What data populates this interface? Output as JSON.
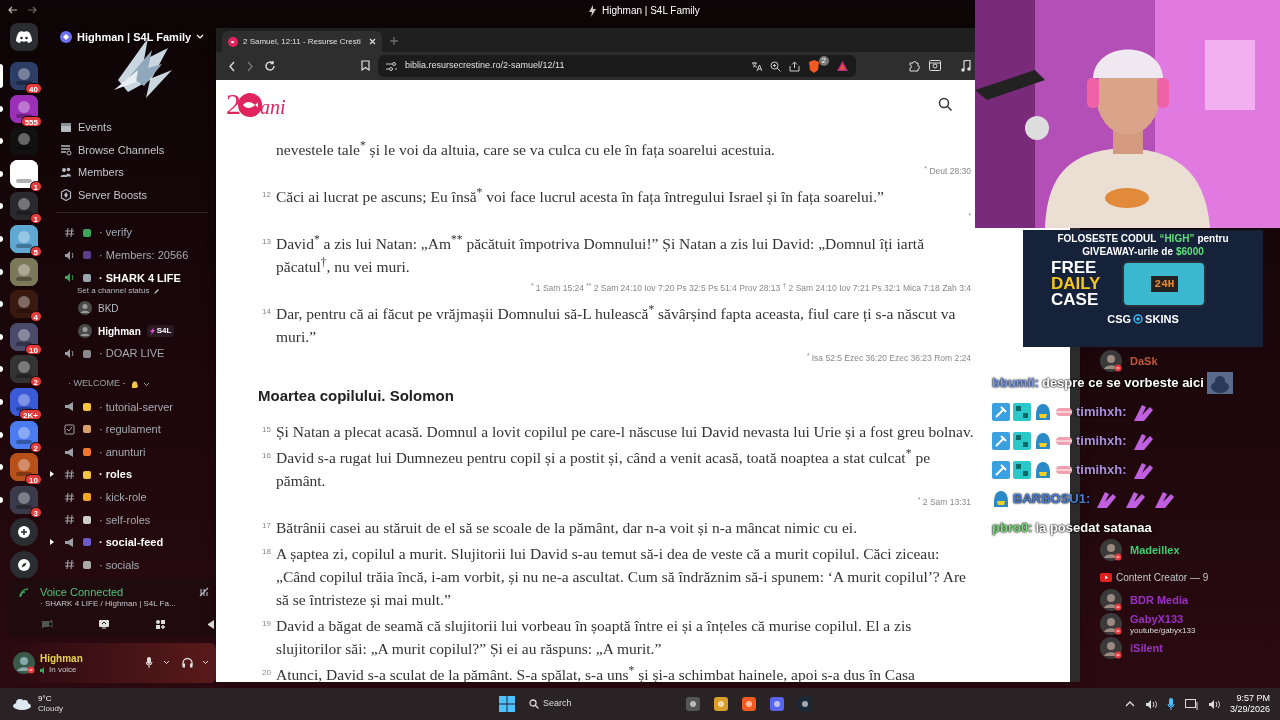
{
  "window_title": "Highman | S4L Family",
  "servers": [
    {
      "kind": "home",
      "selected": false,
      "unread": false,
      "color": "#2b2d31"
    },
    {
      "kind": "server",
      "selected": true,
      "unread": false,
      "badge": "40",
      "color": "#2c3e66"
    },
    {
      "kind": "server",
      "selected": false,
      "unread": true,
      "badge": "555",
      "color": "#9b2fb8"
    },
    {
      "kind": "server",
      "selected": false,
      "unread": true,
      "color": "#111111"
    },
    {
      "kind": "server",
      "selected": false,
      "unread": true,
      "badge": "1",
      "color": "#ffffff"
    },
    {
      "kind": "server",
      "selected": false,
      "unread": true,
      "badge": "1",
      "color": "#2a2a2e"
    },
    {
      "kind": "server",
      "selected": false,
      "unread": true,
      "badge": "5",
      "color": "#5fa8d3"
    },
    {
      "kind": "server",
      "selected": false,
      "unread": true,
      "color": "#7a7a5a"
    },
    {
      "kind": "server",
      "selected": false,
      "unread": true,
      "badge": "4",
      "color": "#3a1a10"
    },
    {
      "kind": "server",
      "selected": false,
      "unread": true,
      "badge": "10",
      "color": "#4a4a6a"
    },
    {
      "kind": "server",
      "selected": false,
      "unread": true,
      "badge": "2",
      "color": "#333333"
    },
    {
      "kind": "server",
      "selected": false,
      "unread": true,
      "badge": "2K+",
      "color": "#3a5ad8"
    },
    {
      "kind": "server",
      "selected": false,
      "unread": true,
      "badge": "2",
      "color": "#4a7cf0"
    },
    {
      "kind": "server",
      "selected": false,
      "unread": true,
      "badge": "10",
      "color": "#b8501a"
    },
    {
      "kind": "server",
      "selected": false,
      "unread": true,
      "badge": "3",
      "color": "#3a3a4a"
    },
    {
      "kind": "add",
      "selected": false,
      "unread": false,
      "color": "#2b2d31"
    },
    {
      "kind": "discover",
      "selected": false,
      "unread": false,
      "color": "#2b2d31"
    }
  ],
  "server_name": "Highman | S4L Family",
  "server_menu": [
    {
      "kind": "events",
      "label": "Events"
    },
    {
      "kind": "browse",
      "label": "Browse Channels"
    },
    {
      "kind": "members",
      "label": "Members"
    },
    {
      "kind": "boosts",
      "label": "Server Boosts"
    }
  ],
  "channels": [
    {
      "kind": "text",
      "name": "· verify",
      "bold": false,
      "unread": false,
      "color": "#3ba55c"
    },
    {
      "kind": "voice",
      "name": "· Members: 20566",
      "bold": false,
      "unread": false,
      "color": "#5b3e8c"
    },
    {
      "kind": "voice_active",
      "name": "· SHARK 4 LIFE",
      "bold": true,
      "unread": false,
      "color": "#9aa5b1",
      "status": "Set a channel status",
      "users": [
        {
          "name": "BKD"
        },
        {
          "name": "Highman",
          "tag": "S4L"
        }
      ]
    },
    {
      "kind": "voice",
      "name": "· DOAR LIVE",
      "bold": false,
      "unread": false,
      "color": "#8a8a8a"
    },
    {
      "kind": "category",
      "name": "· WELCOME -",
      "color": "#f5c542"
    },
    {
      "kind": "announcement",
      "name": "· tutorial-server",
      "bold": false,
      "unread": false,
      "color": "#f5c542"
    },
    {
      "kind": "rules",
      "name": "· regulament",
      "bold": false,
      "unread": false,
      "color": "#d9a066"
    },
    {
      "kind": "announcement",
      "name": "· anunturi",
      "bold": false,
      "unread": false,
      "color": "#f2762e"
    },
    {
      "kind": "text",
      "name": "· roles",
      "bold": true,
      "unread": true,
      "color": "#f5c542"
    },
    {
      "kind": "text",
      "name": "· kick-role",
      "bold": false,
      "unread": false,
      "color": "#f5a623"
    },
    {
      "kind": "text",
      "name": "· self-roles",
      "bold": false,
      "unread": false,
      "color": "#cccccc"
    },
    {
      "kind": "announcement",
      "name": "· social-feed",
      "bold": true,
      "unread": true,
      "color": "#6a5acd"
    },
    {
      "kind": "text",
      "name": "· socials",
      "bold": false,
      "unread": false,
      "color": "#aaaaaa"
    }
  ],
  "voice_panel": {
    "title": "Voice Connected",
    "subtitle": "· SHARK 4 LIFE / Highman | S4L Fa..."
  },
  "user_panel": {
    "name": "Highman",
    "status": "In voice"
  },
  "browser": {
    "tab": "2 Samuel, 12:11 - Resurse Crești",
    "url": "biblia.resursecrestine.ro/2-samuel/12/11",
    "shield_count": "2",
    "logo_before": "2",
    "logo_after": "ani"
  },
  "passage": [
    {
      "kind": "verse",
      "text": "nevestele tale$^{*}$ și le voi da altuia, care se va culca cu ele în fața soarelui acestuia.",
      "footnote": "$^{*}$ Deut 28:30"
    },
    {
      "kind": "verse",
      "number": "12",
      "text": "Căci ai lucrat pe ascuns; Eu însă$^{*}$ voi face lucrul acesta în fața întregului Israel și în fața soarelui.”",
      "footnote": "$^{*}$"
    },
    {
      "kind": "verse",
      "number": "13",
      "text": "David$^{*}$ a zis lui Natan: „Am$^{**}$ păcătuit împotriva Domnului!” Și Natan a zis lui David: „Domnul îți iartă păcatul$^{†}$, nu vei muri.",
      "footnote": "$^{*}$ 1 Sam 15:24 $^{**}$ 2 Sam 24:10 Iov 7:20 Ps 32:5 Ps 51:4 Prov 28:13 $^{†}$ 2 Sam 24:10 Iov 7:21 Ps 32:1 Mica 7:18 Zah 3:4"
    },
    {
      "kind": "verse",
      "number": "14",
      "text": "Dar, pentru că ai făcut pe vrăjmașii Domnului să-L hulească$^{*}$ săvârșind fapta aceasta, fiul care ți s-a născut va muri.”",
      "footnote": "$^{*}$ Isa 52:5 Ezec 36:20 Ezec 36:23 Rom 2:24"
    },
    {
      "kind": "heading",
      "text": "Moartea copilului. Solomon"
    },
    {
      "kind": "verse",
      "number": "15",
      "text": "Și Natan a plecat acasă. Domnul a lovit copilul pe care-l născuse lui David nevasta lui Urie și a fost greu bolnav."
    },
    {
      "kind": "verse",
      "number": "16",
      "text": "David s-a rugat lui Dumnezeu pentru copil și a postit și, când a venit acasă, toată noaptea a stat culcat$^{*}$ pe pământ.",
      "footnote": "$^{*}$ 2 Sam 13:31"
    },
    {
      "kind": "verse",
      "number": "17",
      "text": "Bătrânii casei au stăruit de el să se scoale de la pământ, dar n-a voit și n-a mâncat nimic cu ei."
    },
    {
      "kind": "verse",
      "number": "18",
      "text": "A șaptea zi, copilul a murit. Slujitorii lui David s-au temut să-i dea de veste că a murit copilul. Căci ziceau: „Când copilul trăia încă, i-am vorbit, și nu ne-a ascultat. Cum să îndrăznim să-i spunem: ‘A murit copilul’? Are să se întristeze și mai mult.”"
    },
    {
      "kind": "verse",
      "number": "19",
      "text": "David a băgat de seamă că slujitorii lui vorbeau în șoaptă între ei și a înțeles că murise copilul. El a zis slujitorilor săi: „A murit copilul?” Și ei au răspuns: „A murit.”"
    },
    {
      "kind": "verse",
      "number": "20",
      "text": "Atunci, David s-a sculat de la pământ. S-a spălat, s-a uns$^{*}$ și și-a schimbat hainele, apoi s-a dus în Casa"
    }
  ],
  "ad": {
    "line1": "FOLOSESTE CODUL",
    "code": "“HIGH”",
    "line1_end": "pentru",
    "line2": "GIVEAWAY-urile de",
    "amount": "$6000",
    "free": "FREE",
    "daily": "DAILY",
    "case": "CASE",
    "case_label": "24H",
    "brand_left": "CSG",
    "brand_right": "SKINS"
  },
  "members_top": [
    {
      "name": "DaSk",
      "color": "#c0563a"
    }
  ],
  "members_bottom": [
    {
      "kind": "member",
      "name": "Madeillex",
      "color": "#3bd16f"
    },
    {
      "kind": "role",
      "name": "Content Creator — 9"
    },
    {
      "kind": "member",
      "name": "BDR Media",
      "color": "#9b30c7"
    },
    {
      "kind": "member",
      "name": "GabyX133",
      "color": "#9b30c7",
      "status": "youtube/gabyx133"
    },
    {
      "kind": "member",
      "name": "iSilent",
      "color": "#9b30c7"
    }
  ],
  "chat": [
    {
      "user": "bbumii:",
      "color": "#7b9cf0",
      "message": "despre ce se vorbeste aici",
      "emotes": [
        {
          "kind": "cat"
        }
      ]
    },
    {
      "user": "timihxh:",
      "color": "#b48fe0",
      "badges": [
        {
          "kind": "hammer"
        },
        {
          "kind": "sub"
        },
        {
          "kind": "shark"
        },
        {
          "kind": "pill"
        }
      ],
      "emotes": [
        {
          "kind": "hands"
        }
      ]
    },
    {
      "user": "timihxh:",
      "color": "#b48fe0",
      "badges": [
        {
          "kind": "hammer"
        },
        {
          "kind": "sub"
        },
        {
          "kind": "shark"
        },
        {
          "kind": "pill"
        }
      ],
      "emotes": [
        {
          "kind": "hands"
        }
      ]
    },
    {
      "user": "timihxh:",
      "color": "#b48fe0",
      "badges": [
        {
          "kind": "hammer"
        },
        {
          "kind": "sub"
        },
        {
          "kind": "shark"
        },
        {
          "kind": "pill"
        }
      ],
      "emotes": [
        {
          "kind": "hands"
        }
      ]
    },
    {
      "user": "BARBOSU1:",
      "color": "#4a7fd8",
      "badges": [
        {
          "kind": "shark"
        }
      ],
      "emotes": [
        {
          "kind": "hands"
        },
        {
          "kind": "hands"
        },
        {
          "kind": "hands"
        }
      ]
    },
    {
      "user": "pbro0:",
      "color": "#7be07b",
      "message": "la posedat satanaa"
    }
  ],
  "taskbar": {
    "temperature": "9°C",
    "weather": "Cloudy",
    "search": "Search",
    "time": "9:57 PM",
    "date": "3/29/2026"
  }
}
